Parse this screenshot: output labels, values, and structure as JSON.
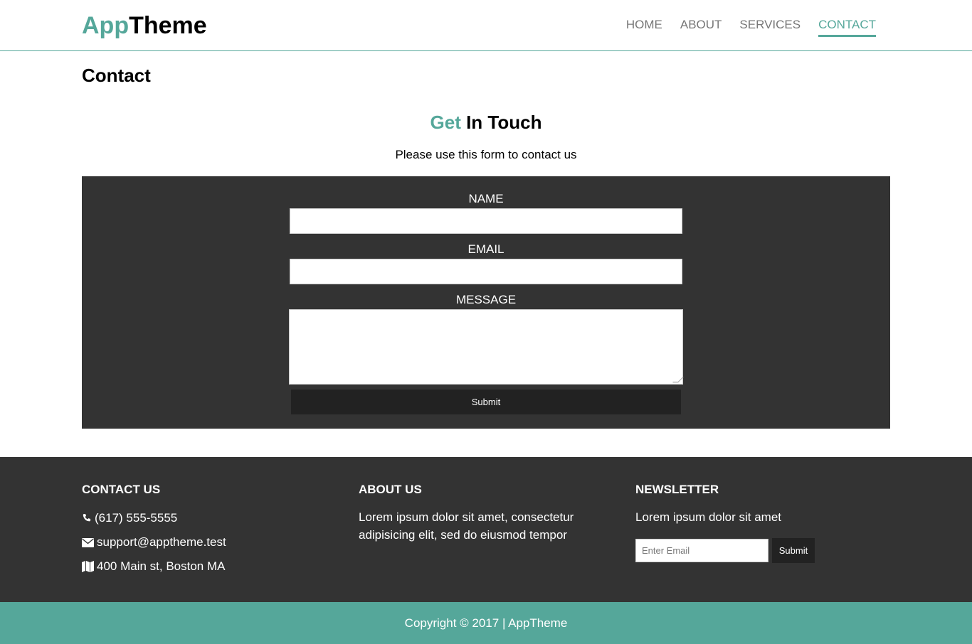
{
  "header": {
    "logo_accent": "App",
    "logo_main": "Theme",
    "nav": [
      {
        "label": "HOME"
      },
      {
        "label": "ABOUT"
      },
      {
        "label": "SERVICES"
      },
      {
        "label": "CONTACT",
        "active": true
      }
    ]
  },
  "page": {
    "title": "Contact",
    "heading_accent": "Get",
    "heading_main": " In Touch",
    "subheading": "Please use this form to contact us"
  },
  "form": {
    "name_label": "NAME",
    "name_value": "",
    "email_label": "EMAIL",
    "email_value": "",
    "message_label": "MESSAGE",
    "message_value": "",
    "submit_label": "Submit"
  },
  "footer": {
    "contact": {
      "title": "CONTACT US",
      "phone": "(617) 555-5555",
      "email": "support@apptheme.test",
      "address": "400 Main st, Boston MA"
    },
    "about": {
      "title": "ABOUT US",
      "text": "Lorem ipsum dolor sit amet, consectetur adipisicing elit, sed do eiusmod tempor"
    },
    "newsletter": {
      "title": "NEWSLETTER",
      "text": "Lorem ipsum dolor sit amet",
      "email_placeholder": "Enter Email",
      "submit_label": "Submit"
    },
    "copyright": "Copyright © 2017 | AppTheme"
  },
  "colors": {
    "accent": "#55a79a",
    "panel": "#333333",
    "button": "#222222"
  },
  "icons": {
    "phone": "phone-icon",
    "email": "envelope-icon",
    "address": "map-icon"
  }
}
